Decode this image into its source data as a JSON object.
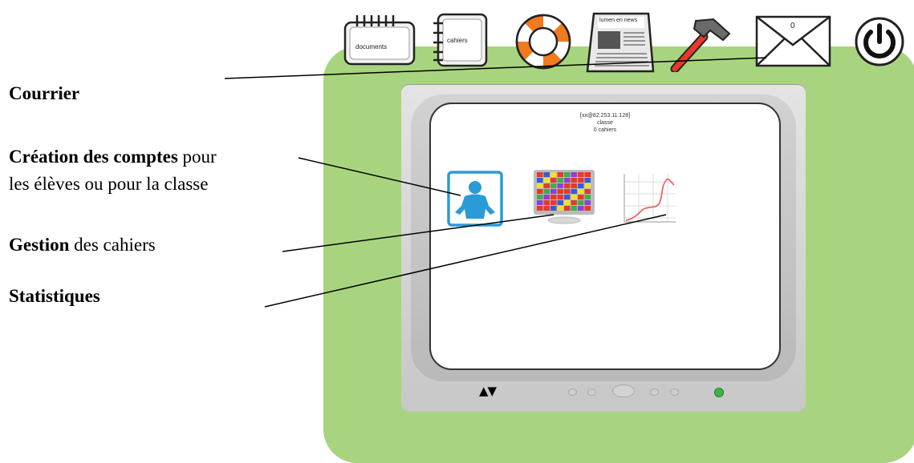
{
  "annotations": {
    "courrier": {
      "bold": "Courrier",
      "rest": ""
    },
    "creation": {
      "bold": "Création des comptes",
      "rest": " pour",
      "line2": "les élèves ou pour la classe"
    },
    "gestion": {
      "bold": "Gestion",
      "rest": " des cahiers"
    },
    "statistiques": {
      "bold": "Statistiques",
      "rest": ""
    }
  },
  "toolbar": {
    "documents_label": "documents",
    "cahiers_label": "cahiers",
    "news_label": "lumen eri news",
    "mail_count": "0"
  },
  "screen": {
    "line1": "[xx@82.253.11.128]",
    "line2": "classe",
    "line3": "0 cahiers"
  },
  "bezel": {
    "nav_arrows": "▲▼"
  },
  "icons": {
    "documents": "notebook-icon",
    "cahiers": "spiral-notebook-icon",
    "help": "lifebuoy-icon",
    "news": "newspaper-icon",
    "tools": "hammer-icon",
    "mail": "envelope-icon",
    "power": "power-icon",
    "accounts": "person-icon",
    "gestion": "color-grid-icon",
    "stats": "line-chart-icon"
  },
  "colors": {
    "panel_green": "#a8d47f",
    "accent_blue": "#2a9bd6",
    "power_led": "#3fb24a"
  }
}
